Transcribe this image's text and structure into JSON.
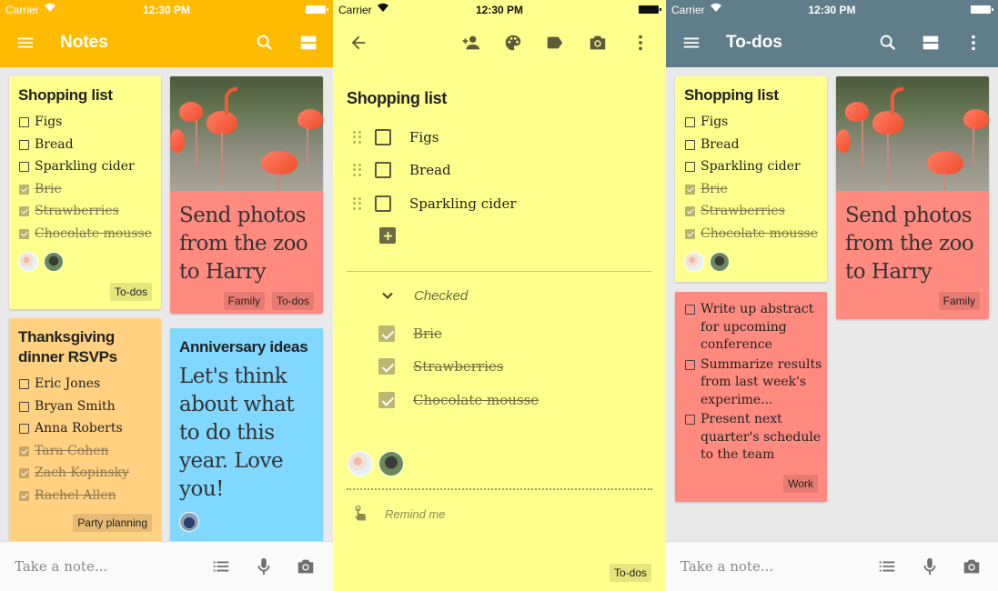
{
  "status_bar": {
    "carrier": "Carrier",
    "time": "12:30 PM"
  },
  "screen1": {
    "title": "Notes",
    "accent_color": "#ffbb00",
    "icons": [
      "menu-icon",
      "search-icon",
      "view-toggle-icon"
    ],
    "cards": {
      "shopping": {
        "title": "Shopping list",
        "items": [
          {
            "text": "Figs",
            "checked": false
          },
          {
            "text": "Bread",
            "checked": false
          },
          {
            "text": "Sparkling cider",
            "checked": false
          },
          {
            "text": "Brie",
            "checked": true
          },
          {
            "text": "Strawberries",
            "checked": true
          },
          {
            "text": "Chocolate mousse",
            "checked": true
          }
        ],
        "label": "To-dos"
      },
      "thanksgiving": {
        "title": "Thanksgiving dinner RSVPs",
        "items": [
          {
            "text": "Eric Jones",
            "checked": false
          },
          {
            "text": "Bryan Smith",
            "checked": false
          },
          {
            "text": "Anna Roberts",
            "checked": false
          },
          {
            "text": "Tara Cohen",
            "checked": true
          },
          {
            "text": "Zach Kopinsky",
            "checked": true
          },
          {
            "text": "Rachel Allen",
            "checked": true
          }
        ],
        "label": "Party planning"
      },
      "zoo": {
        "text_line1": "Send photos",
        "text_line2": "from the zoo",
        "text_line3": "to Harry",
        "labels": [
          "Family",
          "To-dos"
        ]
      },
      "anniversary": {
        "title": "Anniversary ideas",
        "lines": [
          "Let's think",
          "about what",
          "to do this",
          "year. Love",
          "you!"
        ]
      }
    },
    "bottom": {
      "placeholder": "Take a note..."
    }
  },
  "screen2": {
    "title": "Shopping list",
    "toolbar_icons": [
      "back-arrow-icon",
      "add-collaborator-icon",
      "palette-icon",
      "label-icon",
      "camera-icon",
      "more-vert-icon"
    ],
    "unchecked": [
      "Figs",
      "Bread",
      "Sparkling cider"
    ],
    "checked_header": "Checked",
    "checked": [
      "Brie",
      "Strawberries",
      "Chocolate mousse"
    ],
    "remind": "Remind me",
    "label": "To-dos"
  },
  "screen3": {
    "title": "To-dos",
    "accent_color": "#607d8b",
    "cards": {
      "shopping": {
        "title": "Shopping list",
        "items": [
          {
            "text": "Figs",
            "checked": false
          },
          {
            "text": "Bread",
            "checked": false
          },
          {
            "text": "Sparkling cider",
            "checked": false
          },
          {
            "text": "Brie",
            "checked": true
          },
          {
            "text": "Strawberries",
            "checked": true
          },
          {
            "text": "Chocolate mousse",
            "checked": true
          }
        ]
      },
      "work": {
        "items": [
          "Write up abstract for upcoming conference",
          "Summarize results from last week's experime...",
          "Present next quarter's schedule to the team"
        ],
        "label": "Work"
      },
      "zoo": {
        "text_line1": "Send photos",
        "text_line2": "from the zoo",
        "text_line3": "to Harry",
        "label": "Family"
      }
    },
    "bottom": {
      "placeholder": "Take a note..."
    }
  }
}
